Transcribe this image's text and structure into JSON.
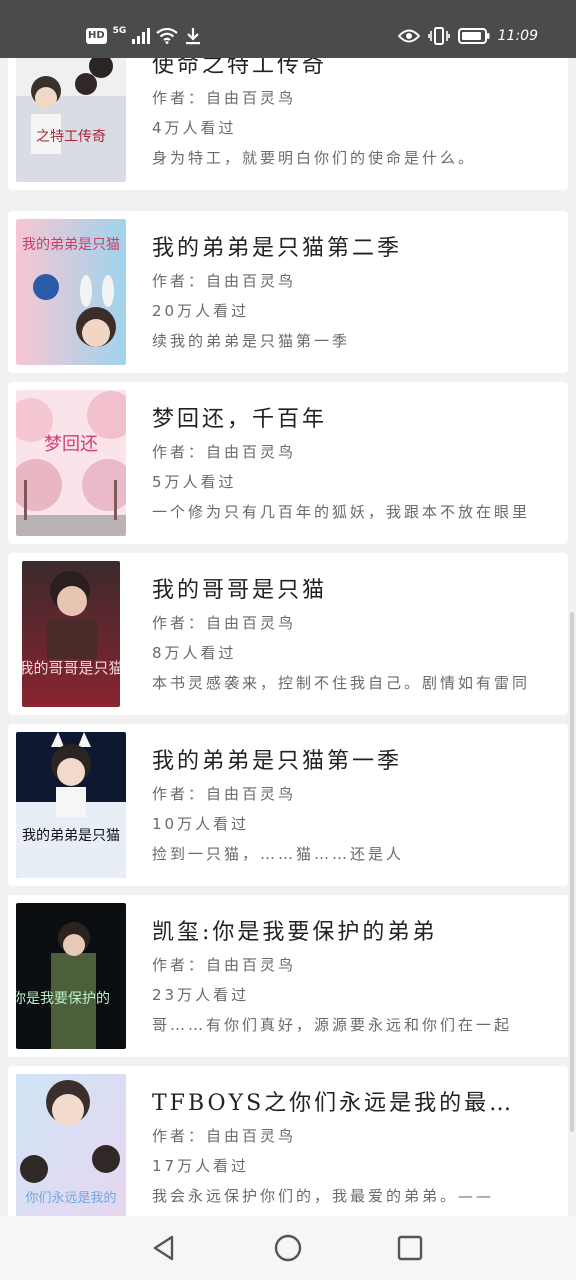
{
  "status_bar": {
    "hd": "HD",
    "network": "5G",
    "time": "11:09",
    "icons": [
      "signal-icon",
      "wifi-icon",
      "download-icon",
      "eye-icon",
      "vibrate-icon",
      "battery-icon"
    ]
  },
  "books": [
    {
      "title": "使命之特工传奇",
      "author": "作者：自由百灵鸟",
      "views": "4万人看过",
      "desc": "身为特工，就要明白你们的使命是什么。",
      "cover_caption": "之特工传奇",
      "cover_colors": [
        "#eef0f2",
        "#c9ced6"
      ]
    },
    {
      "title": "我的弟弟是只猫第二季",
      "author": "作者：自由百灵鸟",
      "views": "20万人看过",
      "desc": "续我的弟弟是只猫第一季",
      "cover_caption": "我的弟弟是只猫",
      "cover_colors": [
        "#f7c6d3",
        "#9fd3ec"
      ]
    },
    {
      "title": "梦回还，千百年",
      "author": "作者：自由百灵鸟",
      "views": "5万人看过",
      "desc": "一个修为只有几百年的狐妖，我跟本不放在眼里",
      "cover_caption": "梦回还",
      "cover_colors": [
        "#fbe3ea",
        "#d9c4c9"
      ]
    },
    {
      "title": "我的哥哥是只猫",
      "author": "作者：自由百灵鸟",
      "views": "8万人看过",
      "desc": "本书灵感袭来，控制不住我自己。剧情如有雷同",
      "cover_caption": "我的哥哥是只猫",
      "cover_colors": [
        "#3b2a2c",
        "#8a2430"
      ]
    },
    {
      "title": "我的弟弟是只猫第一季",
      "author": "作者：自由百灵鸟",
      "views": "10万人看过",
      "desc": "捡到一只猫，……猫……还是人",
      "cover_caption": "我的弟弟是只猫",
      "cover_colors": [
        "#0e1830",
        "#e8eef5"
      ]
    },
    {
      "title": "凯玺:你是我要保护的弟弟",
      "author": "作者：自由百灵鸟",
      "views": "23万人看过",
      "desc": "哥……有你们真好，源源要永远和你们在一起",
      "cover_caption": "你是我要保护的",
      "cover_colors": [
        "#0c0f12",
        "#4d5f3a"
      ]
    },
    {
      "title": "TFBOYS之你们永远是我的最爱弟弟",
      "author": "作者：自由百灵鸟",
      "views": "17万人看过",
      "desc": "我会永远保护你们的，我最爱的弟弟。——",
      "cover_caption": "你们永远是我的",
      "cover_colors": [
        "#cfe4f5",
        "#e7d6f0"
      ]
    }
  ],
  "nav": {
    "back": "back-icon",
    "home": "home-icon",
    "recents": "recents-icon"
  }
}
